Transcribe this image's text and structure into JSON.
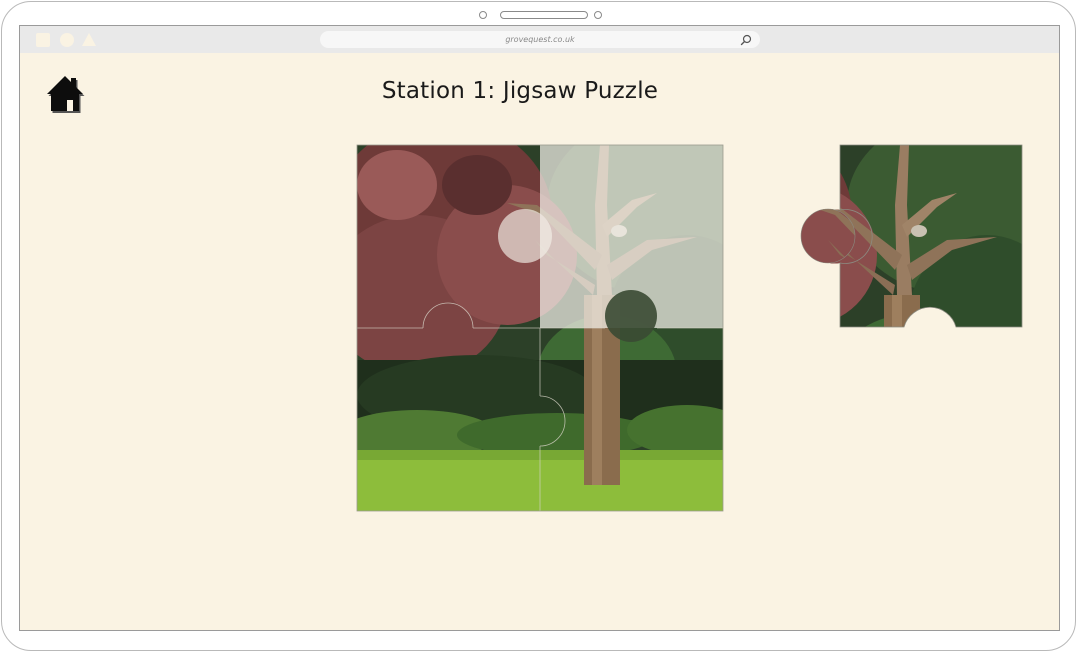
{
  "browser": {
    "url": "grovequest.co.uk"
  },
  "icons": {
    "home": "home-icon",
    "search": "search-icon"
  },
  "page": {
    "title": "Station 1: Jigsaw Puzzle"
  },
  "colors": {
    "background": "#faf3e3",
    "toolbar": "#e9e9e9",
    "foliage_red": "#7a3a3a",
    "foliage_green": "#2f4a2a",
    "grass": "#8fbf3a",
    "trunk": "#8a6a4a"
  },
  "puzzle": {
    "board_pieces": [
      {
        "name": "top-left",
        "placed": true
      },
      {
        "name": "top-right",
        "placed": false
      },
      {
        "name": "bottom-left",
        "placed": true
      },
      {
        "name": "bottom-right",
        "placed": true
      }
    ],
    "loose_piece": "top-right"
  }
}
